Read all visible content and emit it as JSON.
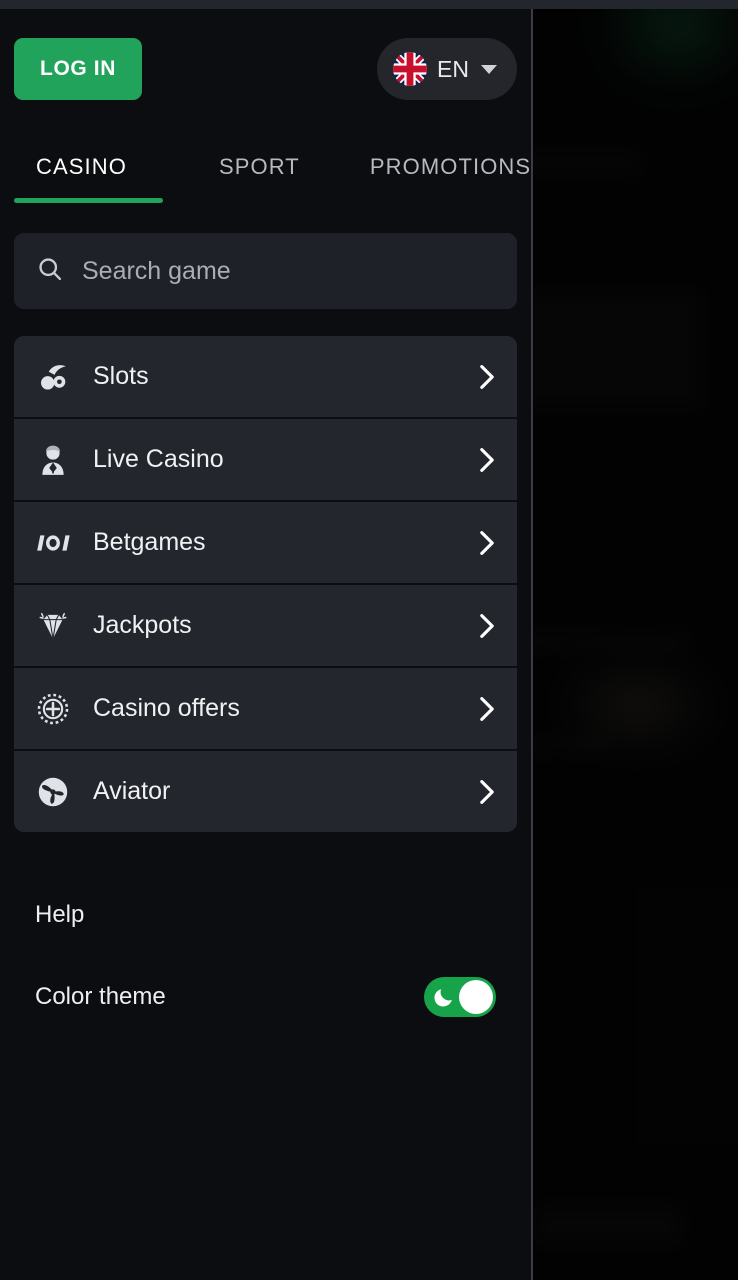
{
  "app": {
    "theme_background": "#0c0d10",
    "accent_green": "#22a35c",
    "card_background": "#23262c",
    "search_background": "#1e2128"
  },
  "header": {
    "login_label": "LOG IN",
    "language": {
      "code": "EN",
      "flag_icon": "uk-flag-icon",
      "caret_icon": "chevron-down-icon"
    }
  },
  "tabs": [
    {
      "label": "CASINO",
      "active": true
    },
    {
      "label": "SPORT",
      "active": false
    },
    {
      "label": "PROMOTIONS",
      "active": false
    }
  ],
  "search": {
    "placeholder": "Search game",
    "value": "",
    "icon": "search-icon"
  },
  "menu": {
    "items": [
      {
        "label": "Slots",
        "icon": "cherries-icon",
        "chevron": "chevron-right-icon"
      },
      {
        "label": "Live Casino",
        "icon": "dealer-icon",
        "chevron": "chevron-right-icon"
      },
      {
        "label": "Betgames",
        "icon": "betgames-icon",
        "chevron": "chevron-right-icon"
      },
      {
        "label": "Jackpots",
        "icon": "diamond-icon",
        "chevron": "chevron-right-icon"
      },
      {
        "label": "Casino offers",
        "icon": "casino-chip-icon",
        "chevron": "chevron-right-icon"
      },
      {
        "label": "Aviator",
        "icon": "propeller-icon",
        "chevron": "chevron-right-icon"
      }
    ]
  },
  "footer": {
    "help_label": "Help",
    "theme_label": "Color theme",
    "theme_enabled": true,
    "theme_icon": "moon-icon",
    "toggle_color": "#16a34a"
  }
}
